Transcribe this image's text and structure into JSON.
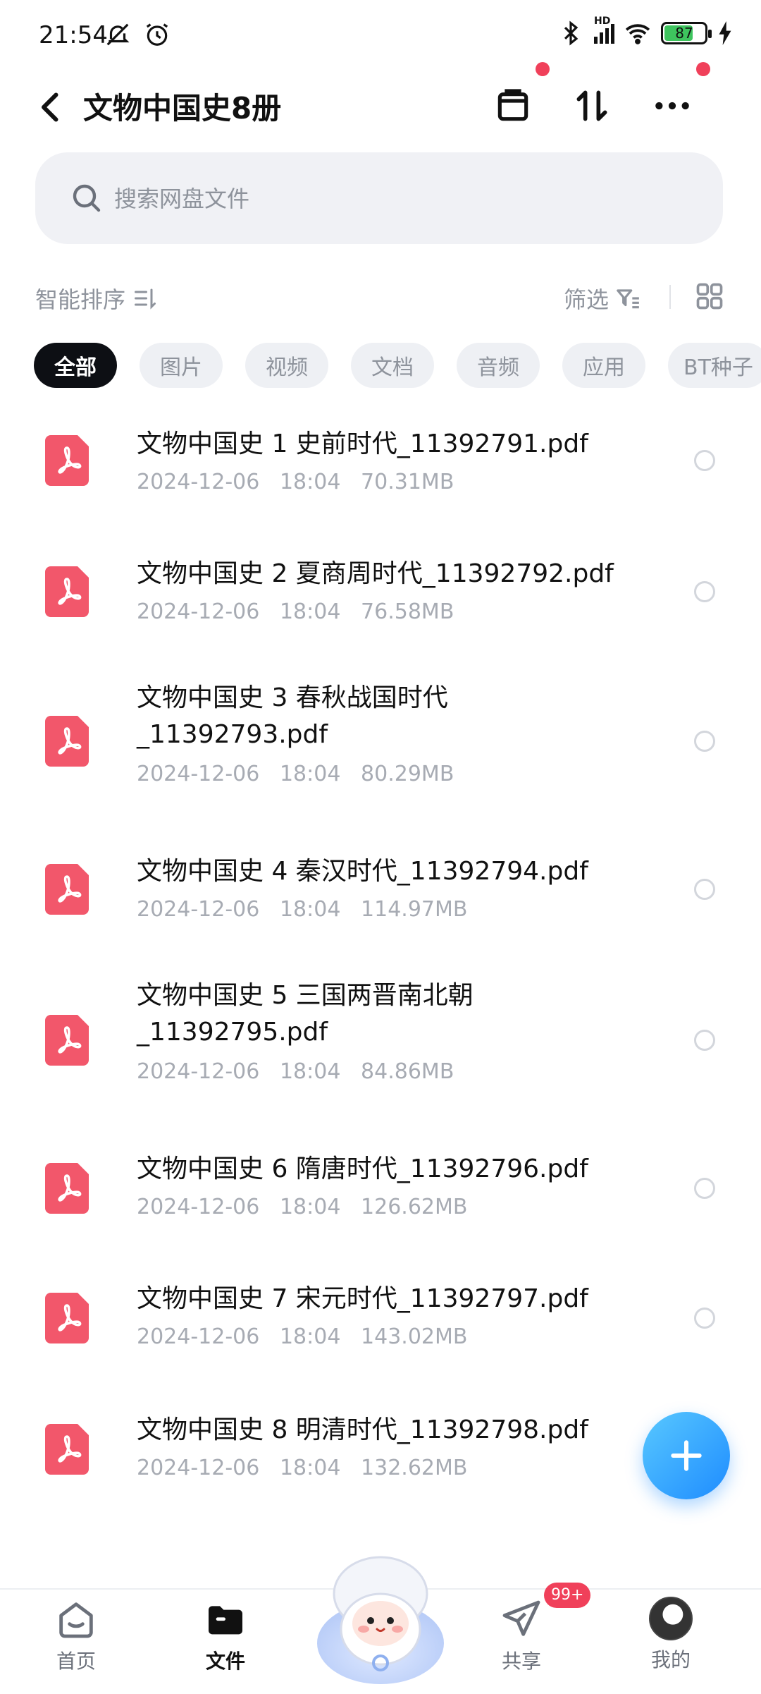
{
  "status_bar": {
    "time": "21:54",
    "battery": "87",
    "network": "HD"
  },
  "header": {
    "title": "文物中国史8册"
  },
  "search": {
    "placeholder": "搜索网盘文件"
  },
  "toolbar": {
    "sort_label": "智能排序",
    "filter_label": "筛选"
  },
  "chips": [
    "全部",
    "图片",
    "视频",
    "文档",
    "音频",
    "应用",
    "BT种子"
  ],
  "files": [
    {
      "name": "文物中国史 1 史前时代_11392791.pdf",
      "date": "2024-12-06",
      "time": "18:04",
      "size": "70.31MB"
    },
    {
      "name": "文物中国史 2 夏商周时代_11392792.pdf",
      "date": "2024-12-06",
      "time": "18:04",
      "size": "76.58MB"
    },
    {
      "name": "文物中国史 3 春秋战国时代_11392793.pdf",
      "date": "2024-12-06",
      "time": "18:04",
      "size": "80.29MB"
    },
    {
      "name": "文物中国史 4 秦汉时代_11392794.pdf",
      "date": "2024-12-06",
      "time": "18:04",
      "size": "114.97MB"
    },
    {
      "name": "文物中国史 5 三国两晋南北朝_11392795.pdf",
      "date": "2024-12-06",
      "time": "18:04",
      "size": "84.86MB"
    },
    {
      "name": "文物中国史 6 隋唐时代_11392796.pdf",
      "date": "2024-12-06",
      "time": "18:04",
      "size": "126.62MB"
    },
    {
      "name": "文物中国史 7 宋元时代_11392797.pdf",
      "date": "2024-12-06",
      "time": "18:04",
      "size": "143.02MB"
    },
    {
      "name": "文物中国史 8 明清时代_11392798.pdf",
      "date": "2024-12-06",
      "time": "18:04",
      "size": "132.62MB"
    }
  ],
  "nav": {
    "home": "首页",
    "files": "文件",
    "share": "共享",
    "mine": "我的",
    "share_badge": "99+"
  },
  "colors": {
    "accent": "#1e8cff",
    "pdf_red": "#f2576b",
    "alert_dot": "#f0405a"
  }
}
